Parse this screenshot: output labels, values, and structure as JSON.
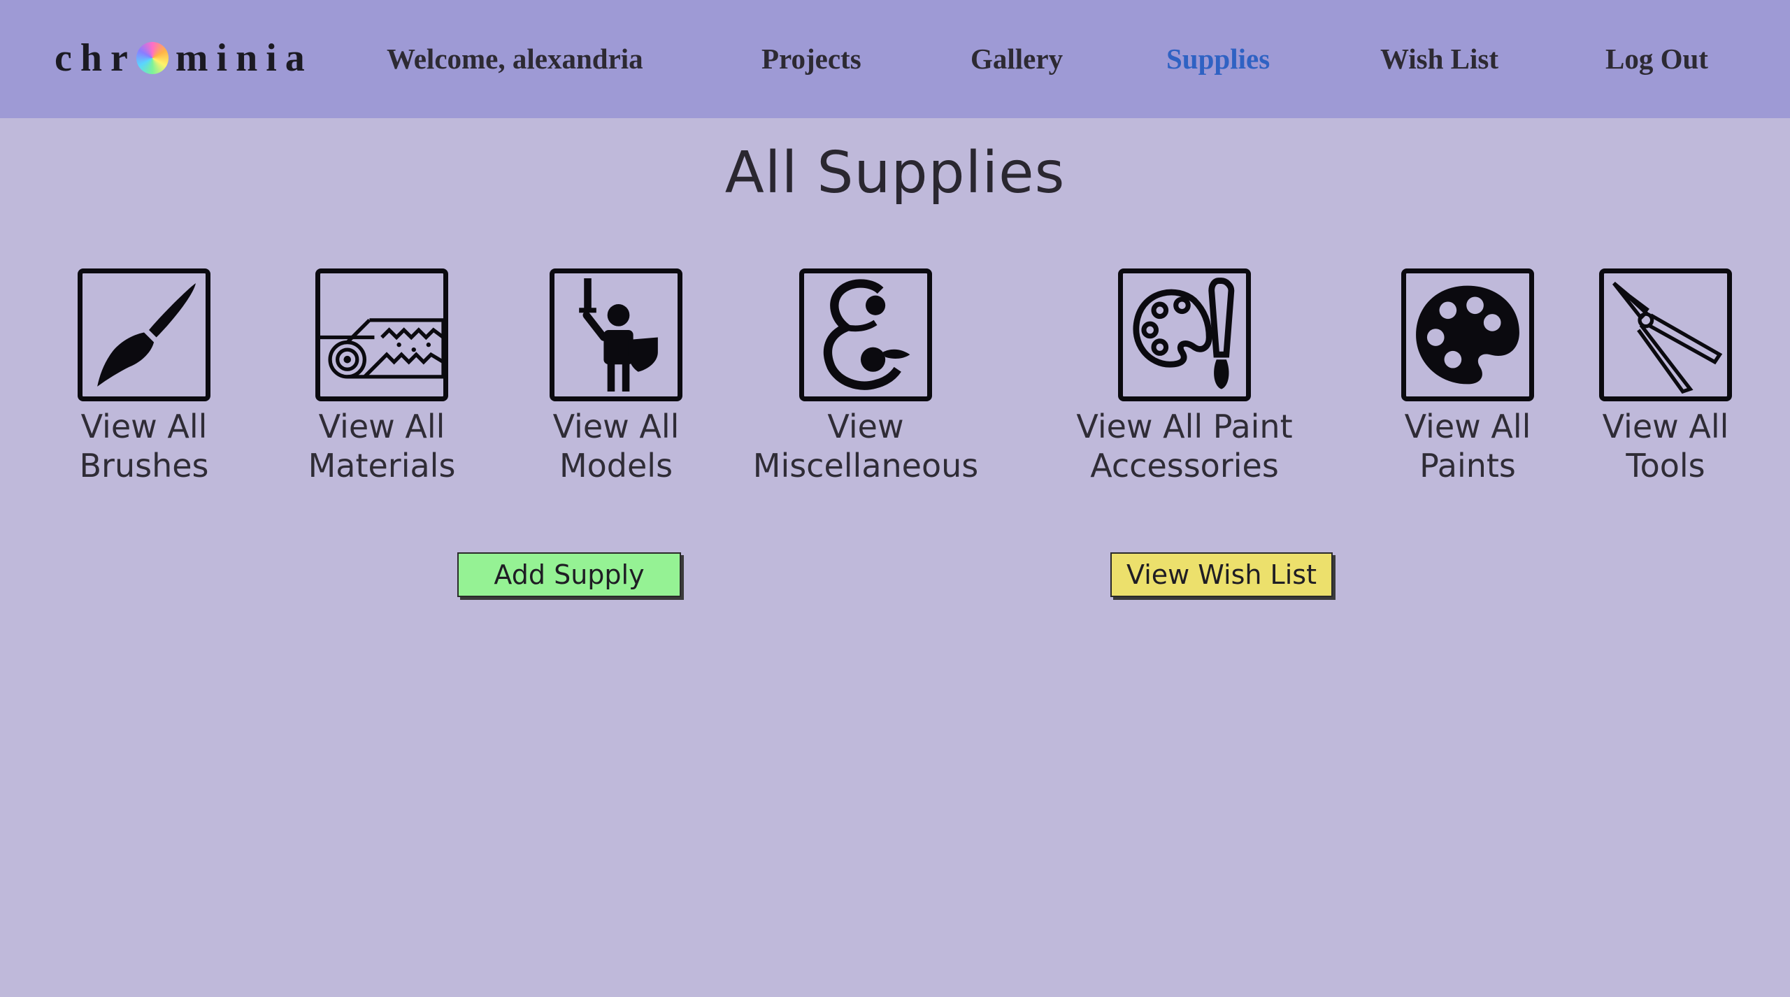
{
  "brand": {
    "name_before": "chr",
    "name_after": "minia",
    "logo_icon": "color-wheel-icon"
  },
  "nav": {
    "welcome": "Welcome, alexandria",
    "projects": "Projects",
    "gallery": "Gallery",
    "supplies": "Supplies",
    "wishlist": "Wish List",
    "logout": "Log Out",
    "active": "Supplies"
  },
  "page": {
    "title": "All Supplies"
  },
  "categories": [
    {
      "label": "View All\nBrushes",
      "icon": "paintbrush-icon"
    },
    {
      "label": "View All\nMaterials",
      "icon": "material-roll-icon"
    },
    {
      "label": "View All\nModels",
      "icon": "miniature-figure-icon"
    },
    {
      "label": "View\nMiscellaneous",
      "icon": "ampersand-icon"
    },
    {
      "label": "View All Paint\nAccessories",
      "icon": "palette-brush-icon"
    },
    {
      "label": "View All\nPaints",
      "icon": "palette-icon"
    },
    {
      "label": "View All\nTools",
      "icon": "pliers-icon"
    }
  ],
  "actions": {
    "add_supply": "Add Supply",
    "view_wish_list": "View Wish List"
  },
  "colors": {
    "navbar": "#9e9ad5",
    "background": "#bfb9da",
    "active_link": "#2f62c3",
    "add_button": "#95f294",
    "wish_button": "#ece06c"
  }
}
